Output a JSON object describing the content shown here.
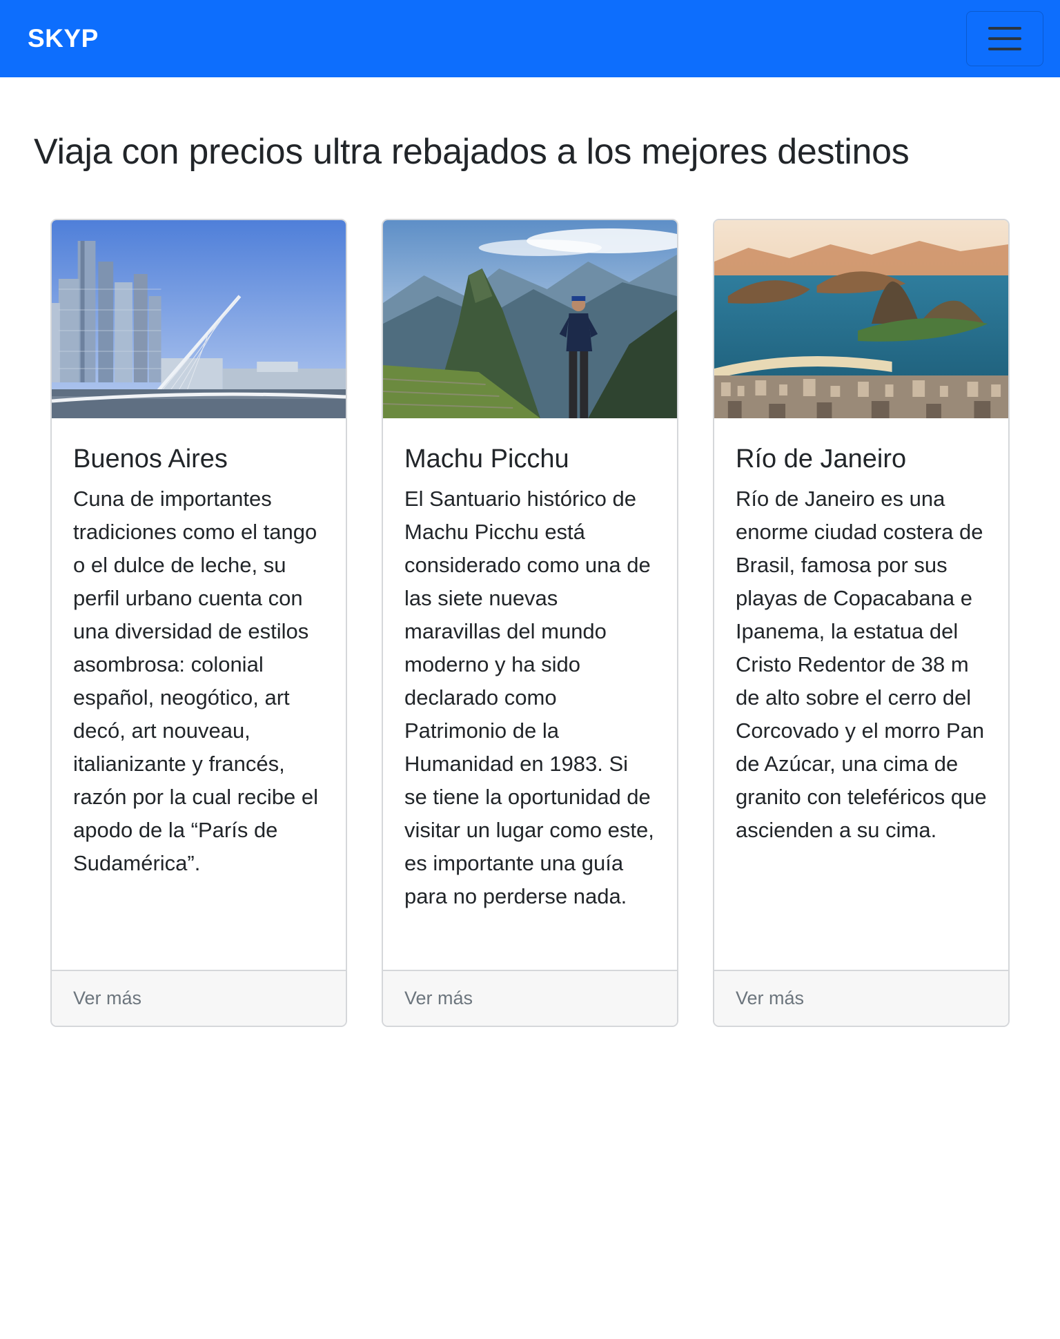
{
  "navbar": {
    "brand": "SKYP",
    "toggler_icon": "hamburger-menu-icon"
  },
  "main": {
    "heading": "Viaja con precios ultra rebajados a los mejores destinos"
  },
  "cards": [
    {
      "title": "Buenos Aires",
      "text": "Cuna de importantes tradiciones como el tango o el dulce de leche, su perfil urbano cuenta con una diversidad de estilos asombrosa: colonial español, neogótico, art decó, art nouveau, italianizante y francés, razón por la cual recibe el apodo de la “París de Sudamérica”.",
      "link": "Ver más",
      "image": "buenos-aires-skyline-photo"
    },
    {
      "title": "Machu Picchu",
      "text": "El Santuario histórico de Machu Picchu está considerado como una de las siete nuevas maravillas del mundo moderno y ha sido declarado como Patrimonio de la Humanidad en 1983. Si se tiene la oportunidad de visitar un lugar como este, es importante una guía para no perderse nada.",
      "link": "Ver más",
      "image": "machu-picchu-mountains-photo"
    },
    {
      "title": "Río de Janeiro",
      "text": "Río de Janeiro es una enorme ciudad costera de Brasil, famosa por sus playas de Copacabana e Ipanema, la estatua del Cristo Redentor de 38 m de alto sobre el cerro del Corcovado y el morro Pan de Azúcar, una cima de granito con teleféricos que ascienden a su cima.",
      "link": "Ver más",
      "image": "rio-de-janeiro-bay-photo"
    }
  ],
  "colors": {
    "primary": "#0d6efd",
    "footer_bg": "#f7f7f7",
    "muted_text": "#6c757d"
  }
}
